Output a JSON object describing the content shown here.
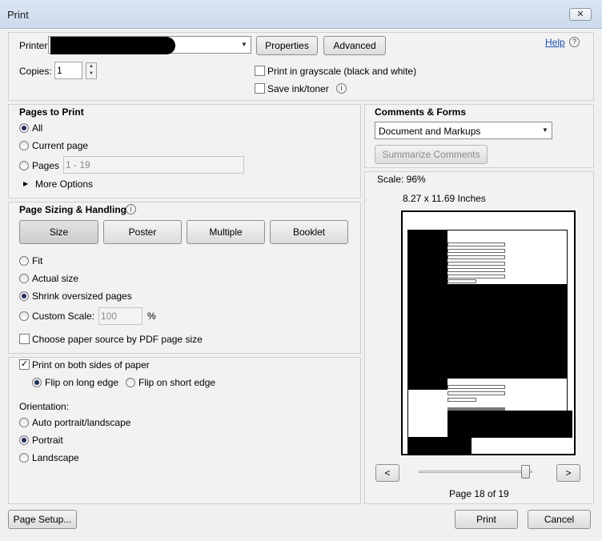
{
  "window": {
    "title": "Print",
    "close_glyph": "✕"
  },
  "printer": {
    "label": "Printer:",
    "name": "",
    "properties": "Properties",
    "advanced": "Advanced",
    "help": "Help",
    "help_glyph": "?"
  },
  "copies": {
    "label": "Copies:",
    "value": "1"
  },
  "options": {
    "grayscale": "Print in grayscale (black and white)",
    "save_ink": "Save ink/toner",
    "info_glyph": "i"
  },
  "pages_to_print": {
    "title": "Pages to Print",
    "all": "All",
    "current": "Current page",
    "pages": "Pages",
    "pages_value": "1 - 19",
    "more": "More Options",
    "selected": "all"
  },
  "sizing": {
    "title": "Page Sizing & Handling",
    "tabs": [
      "Size",
      "Poster",
      "Multiple",
      "Booklet"
    ],
    "fit": "Fit",
    "actual": "Actual size",
    "shrink": "Shrink oversized pages",
    "custom": "Custom Scale:",
    "custom_value": "100",
    "percent": "%",
    "paper_source": "Choose paper source by PDF page size",
    "selected": "shrink"
  },
  "duplex": {
    "label": "Print on both sides of paper",
    "checked": true,
    "long": "Flip on long edge",
    "short": "Flip on short edge",
    "selected": "long"
  },
  "orientation": {
    "title": "Orientation:",
    "auto": "Auto portrait/landscape",
    "portrait": "Portrait",
    "landscape": "Landscape",
    "selected": "portrait"
  },
  "comments": {
    "title": "Comments & Forms",
    "value": "Document and Markups",
    "summarize": "Summarize Comments"
  },
  "preview": {
    "scale": "Scale:  96%",
    "size": "8.27 x 11.69 Inches",
    "page": "Page 18 of 19",
    "prev": "<",
    "next": ">",
    "slider_fraction": 0.94
  },
  "footer": {
    "page_setup": "Page Setup...",
    "print": "Print",
    "cancel": "Cancel"
  }
}
